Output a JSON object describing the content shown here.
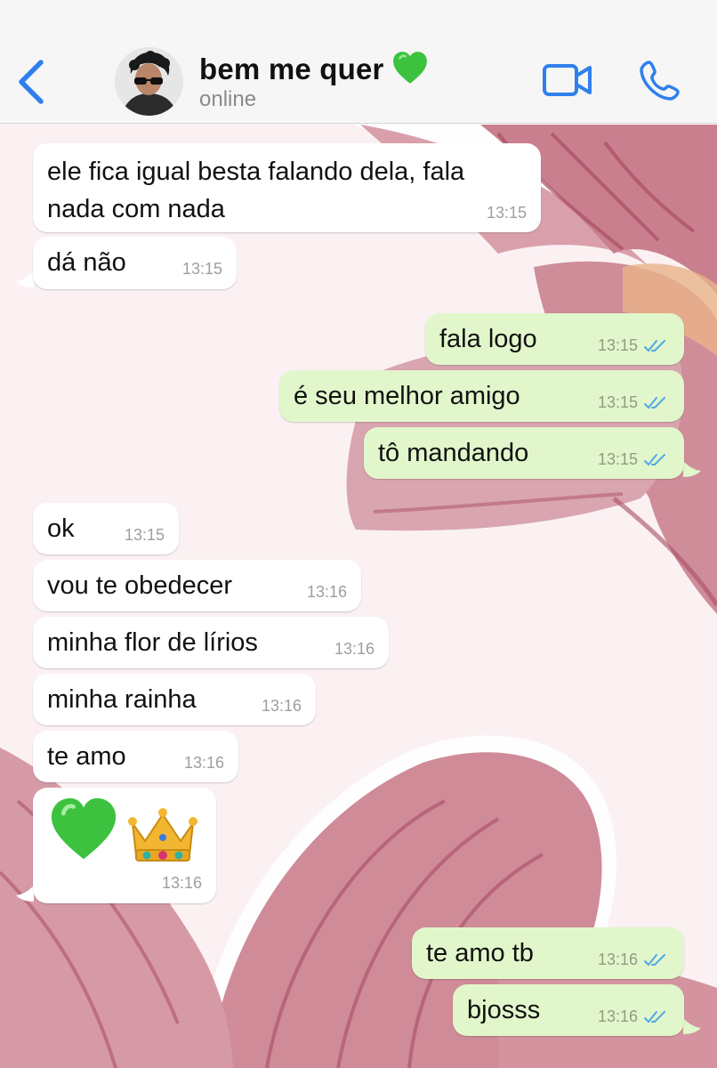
{
  "header": {
    "back_icon": "chevron-left-icon",
    "contact_name": "bem me quer",
    "contact_emoji": "green-heart-icon",
    "status": "online",
    "video_icon": "video-camera-icon",
    "call_icon": "phone-icon"
  },
  "colors": {
    "accent": "#2f80ed",
    "incoming_bubble": "#ffffff",
    "outgoing_bubble": "#e1f7cb",
    "read_ticks": "#4fa8e6",
    "wallpaper_bg": "#fbf1f3",
    "petal": "#c9808f"
  },
  "messages": [
    {
      "direction": "in",
      "text": "ele fica igual besta falando dela, fala\nnada com nada",
      "time": "13:15"
    },
    {
      "direction": "in",
      "text": "dá não",
      "time": "13:15"
    },
    {
      "direction": "out",
      "text": "fala logo",
      "time": "13:15",
      "status": "read"
    },
    {
      "direction": "out",
      "text": "é seu melhor amigo",
      "time": "13:15",
      "status": "read"
    },
    {
      "direction": "out",
      "text": "tô mandando",
      "time": "13:15",
      "status": "read"
    },
    {
      "direction": "in",
      "text": "ok",
      "time": "13:15"
    },
    {
      "direction": "in",
      "text": "vou te obedecer",
      "time": "13:16"
    },
    {
      "direction": "in",
      "text": "minha flor de lírios",
      "time": "13:16"
    },
    {
      "direction": "in",
      "text": "minha rainha",
      "time": "13:16"
    },
    {
      "direction": "in",
      "text": "te amo",
      "time": "13:16"
    },
    {
      "direction": "in",
      "emojis": [
        "green-heart-icon",
        "crown-icon"
      ],
      "time": "13:16"
    },
    {
      "direction": "out",
      "text": "te amo tb",
      "time": "13:16",
      "status": "read"
    },
    {
      "direction": "out",
      "text": "bjosss",
      "time": "13:16",
      "status": "read"
    }
  ]
}
